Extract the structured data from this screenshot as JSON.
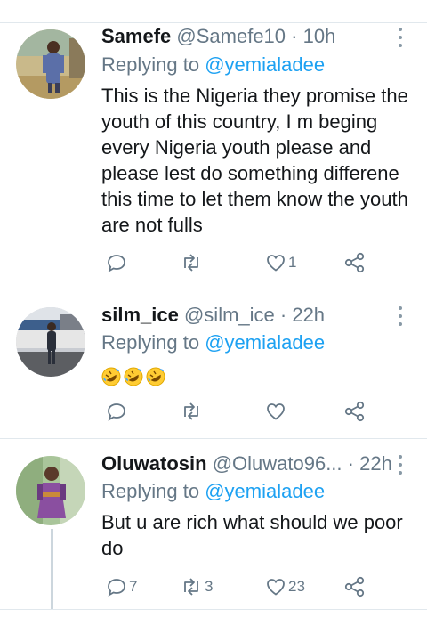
{
  "tweets": [
    {
      "name": "Samefe",
      "handle": "@Samefe10",
      "time": "· 10h",
      "replying_prefix": "Replying to",
      "replying_handle": "@yemialadee",
      "text_lines": [
        "This is the Nigeria they promise the",
        "youth of this country, I m beging",
        "every Nigeria youth please and",
        "please lest do something differene",
        "this time to let them know the youth",
        "are not fulls"
      ],
      "reply_count": "",
      "retweet_count": "",
      "like_count": "1"
    },
    {
      "name": "silm_ice",
      "handle": "@silm_ice",
      "time": "· 22h",
      "replying_prefix": "Replying to",
      "replying_handle": "@yemialadee",
      "emojis": [
        "rolling-on-floor-laughing",
        "rolling-on-floor-laughing",
        "rolling-on-floor-laughing"
      ],
      "reply_count": "",
      "retweet_count": "",
      "like_count": ""
    },
    {
      "name": "Oluwatosin",
      "handle": "@Oluwato96...",
      "time": "· 22h",
      "replying_prefix": "Replying to",
      "replying_handle": "@yemialadee",
      "text_lines": [
        "But u are rich what should we poor",
        "do"
      ],
      "reply_count": "7",
      "retweet_count": "3",
      "like_count": "23"
    }
  ],
  "colors": {
    "link": "#1da1f2",
    "secondary_text": "#657786",
    "primary_text": "#14171a",
    "divider": "#e1e8ed"
  },
  "icons": [
    "reply-icon",
    "retweet-icon",
    "like-icon",
    "share-icon",
    "more-icon"
  ]
}
